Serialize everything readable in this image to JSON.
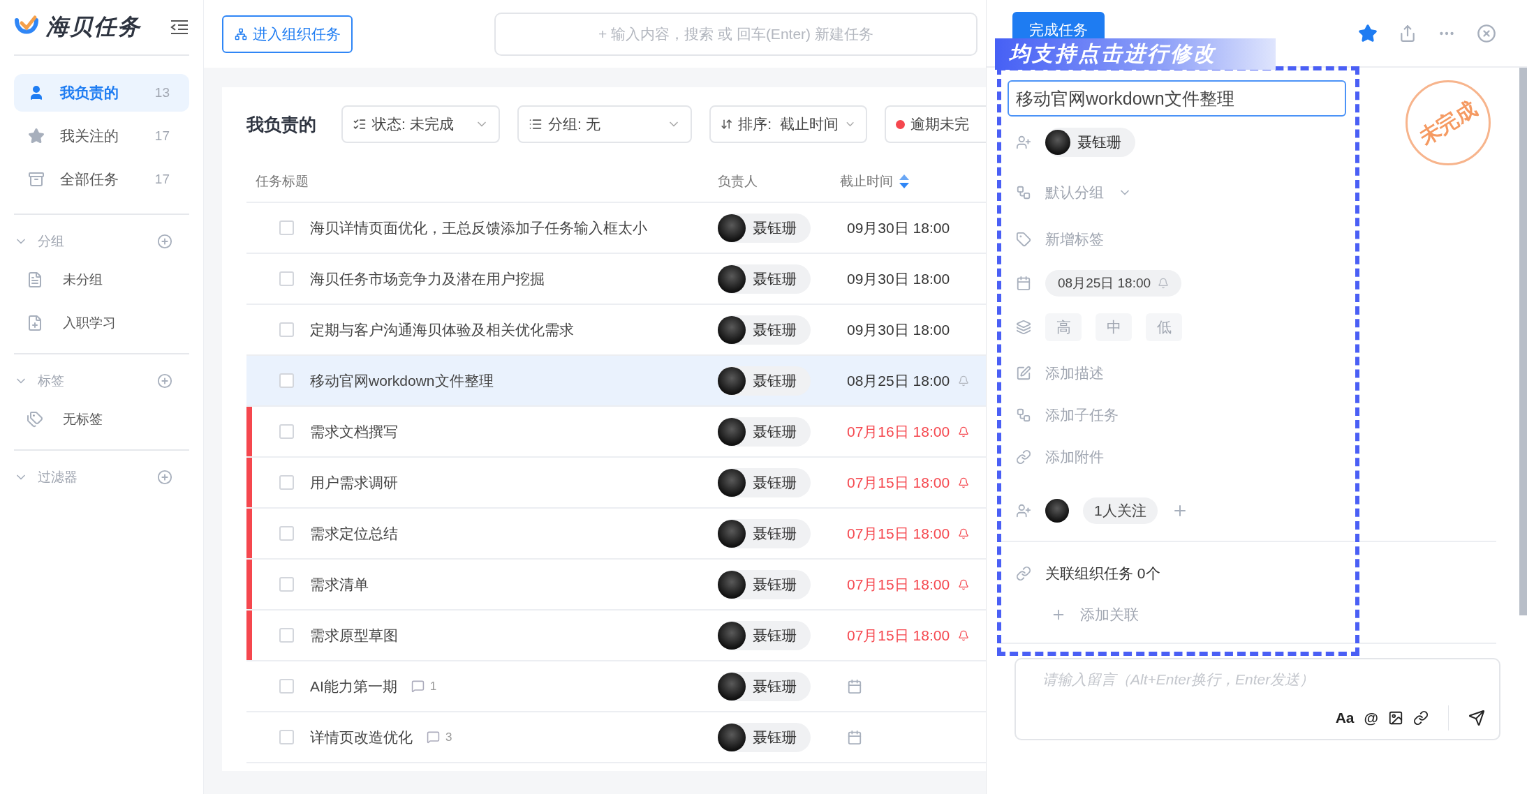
{
  "sidebar": {
    "logo_text": "海贝任务",
    "nav": [
      {
        "kind": "user",
        "label": "我负责的",
        "count": "13",
        "selected": true
      },
      {
        "kind": "star",
        "label": "我关注的",
        "count": "17",
        "selected": false
      },
      {
        "kind": "archive",
        "label": "全部任务",
        "count": "17",
        "selected": false
      }
    ],
    "sections": [
      {
        "title": "分组",
        "items": [
          {
            "kind": "doc",
            "label": "未分组"
          },
          {
            "kind": "doc-add",
            "label": "入职学习"
          }
        ]
      },
      {
        "title": "标签",
        "items": [
          {
            "kind": "tag",
            "label": "无标签"
          }
        ]
      },
      {
        "title": "过滤器"
      }
    ]
  },
  "topbar": {
    "org_button": "进入组织任务",
    "search": {
      "placeholder": "+ 输入内容，搜索 或 回车(Enter) 新建任务"
    }
  },
  "list": {
    "title": "我负责的",
    "filters": [
      {
        "kind": "status",
        "label": "状态: 未完成"
      },
      {
        "kind": "group",
        "label": "分组: 无"
      },
      {
        "kind": "sort",
        "label": "排序:  截止时间"
      },
      {
        "kind": "overdue",
        "label": "逾期未完"
      }
    ],
    "columns": [
      "任务标题",
      "负责人",
      "截止时间"
    ],
    "rows": [
      {
        "title": "海贝详情页面优化，王总反馈添加子任务输入框太小",
        "assignee": "聂钰珊",
        "due": "09月30日 18:00",
        "overdue": false,
        "reminder": false,
        "selected": false
      },
      {
        "title": "海贝任务市场竞争力及潜在用户挖掘",
        "assignee": "聂钰珊",
        "due": "09月30日 18:00",
        "overdue": false,
        "reminder": false,
        "selected": false
      },
      {
        "title": "定期与客户沟通海贝体验及相关优化需求",
        "assignee": "聂钰珊",
        "due": "09月30日 18:00",
        "overdue": false,
        "reminder": false,
        "selected": false
      },
      {
        "title": "移动官网workdown文件整理",
        "assignee": "聂钰珊",
        "due": "08月25日 18:00",
        "overdue": false,
        "reminder": true,
        "selected": true
      },
      {
        "title": "需求文档撰写",
        "assignee": "聂钰珊",
        "due": "07月16日 18:00",
        "overdue": true,
        "reminder": true,
        "selected": false
      },
      {
        "title": "用户需求调研",
        "assignee": "聂钰珊",
        "due": "07月15日 18:00",
        "overdue": true,
        "reminder": true,
        "selected": false
      },
      {
        "title": "需求定位总结",
        "assignee": "聂钰珊",
        "due": "07月15日 18:00",
        "overdue": true,
        "reminder": true,
        "selected": false
      },
      {
        "title": "需求清单",
        "assignee": "聂钰珊",
        "due": "07月15日 18:00",
        "overdue": true,
        "reminder": true,
        "selected": false
      },
      {
        "title": "需求原型草图",
        "assignee": "聂钰珊",
        "due": "07月15日 18:00",
        "overdue": true,
        "reminder": true,
        "selected": false
      },
      {
        "title": "AI能力第一期",
        "comments": "1",
        "assignee": "聂钰珊",
        "overdue": false,
        "reminder": false,
        "selected": false
      },
      {
        "title": "详情页改造优化",
        "comments": "3",
        "assignee": "聂钰珊",
        "overdue": false,
        "reminder": false,
        "selected": false
      }
    ]
  },
  "panel": {
    "complete_button": "完成任务",
    "starred": true,
    "banner": "均支持点击进行修改",
    "title_value": "移动官网workdown文件整理",
    "assignee": "聂钰珊",
    "group": "默认分组",
    "tags_placeholder": "新增标签",
    "due": "08月25日 18:00",
    "priorities": [
      {
        "label": "高",
        "selected": false
      },
      {
        "label": "中",
        "selected": false
      },
      {
        "label": "低",
        "selected": false
      }
    ],
    "actions": [
      {
        "kind": "description",
        "label": "添加描述"
      },
      {
        "kind": "subtask",
        "label": "添加子任务"
      },
      {
        "kind": "attachment",
        "label": "添加附件"
      }
    ],
    "followers": "1人关注",
    "related": "关联组织任务 0个",
    "add_related": "添加关联",
    "stamp": "未完成",
    "comment": {
      "placeholder": "请输入留言（Alt+Enter换行，Enter发送）",
      "tools": [
        {
          "kind": "text",
          "label": "Aa"
        },
        {
          "kind": "text",
          "label": "@"
        },
        {
          "kind": "image"
        },
        {
          "kind": "link"
        }
      ]
    }
  }
}
